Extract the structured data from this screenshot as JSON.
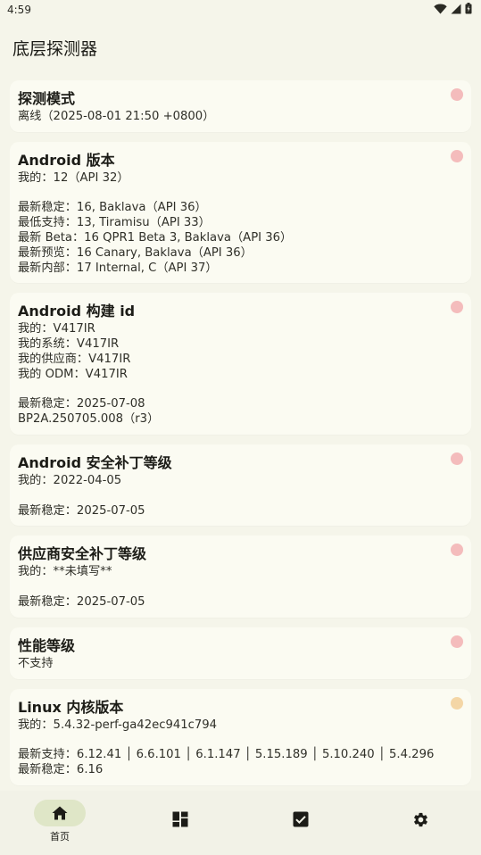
{
  "status_bar": {
    "time": "4:59"
  },
  "app": {
    "title": "底层探测器"
  },
  "colors": {
    "dot_red": "#f4bcbc",
    "dot_orange": "#f4d6a6",
    "nav_active": "#dfe6c7"
  },
  "cards": [
    {
      "title": "探测模式",
      "dot": "red",
      "blocks": [
        [
          "离线（2025-08-01 21:50 +0800）"
        ]
      ]
    },
    {
      "title": "Android 版本",
      "dot": "red",
      "blocks": [
        [
          "我的：12（API 32）"
        ],
        [
          "最新稳定：16, Baklava（API 36）",
          "最低支持：13, Tiramisu（API 33）",
          "最新 Beta：16 QPR1 Beta 3, Baklava（API 36）",
          "最新预览：16 Canary, Baklava（API 36）",
          "最新内部：17 Internal, C（API 37）"
        ]
      ]
    },
    {
      "title": "Android 构建 id",
      "dot": "red",
      "blocks": [
        [
          "我的：V417IR",
          "我的系统：V417IR",
          "我的供应商：V417IR",
          "我的 ODM：V417IR"
        ],
        [
          "最新稳定：2025-07-08",
          "BP2A.250705.008（r3）"
        ]
      ]
    },
    {
      "title": "Android 安全补丁等级",
      "dot": "red",
      "blocks": [
        [
          "我的：2022-04-05"
        ],
        [
          "最新稳定：2025-07-05"
        ]
      ]
    },
    {
      "title": "供应商安全补丁等级",
      "dot": "red",
      "blocks": [
        [
          "我的：**未填写**"
        ],
        [
          "最新稳定：2025-07-05"
        ]
      ]
    },
    {
      "title": "性能等级",
      "dot": "red",
      "blocks": [
        [
          "不支持"
        ]
      ]
    },
    {
      "title": "Linux 内核版本",
      "dot": "orange",
      "blocks": [
        [
          "我的：5.4.32-perf-ga42ec941c794"
        ],
        [
          "最新支持：6.12.41 │ 6.6.101 │ 6.1.147 │ 5.15.189 │ 5.10.240 │ 5.4.296",
          "最新稳定：6.16"
        ]
      ]
    }
  ],
  "bottom_nav": [
    {
      "icon": "home-icon",
      "label": "首页",
      "active": true
    },
    {
      "icon": "dashboard-icon",
      "label": "",
      "active": false
    },
    {
      "icon": "checkbox-icon",
      "label": "",
      "active": false
    },
    {
      "icon": "gear-icon",
      "label": "",
      "active": false
    }
  ]
}
